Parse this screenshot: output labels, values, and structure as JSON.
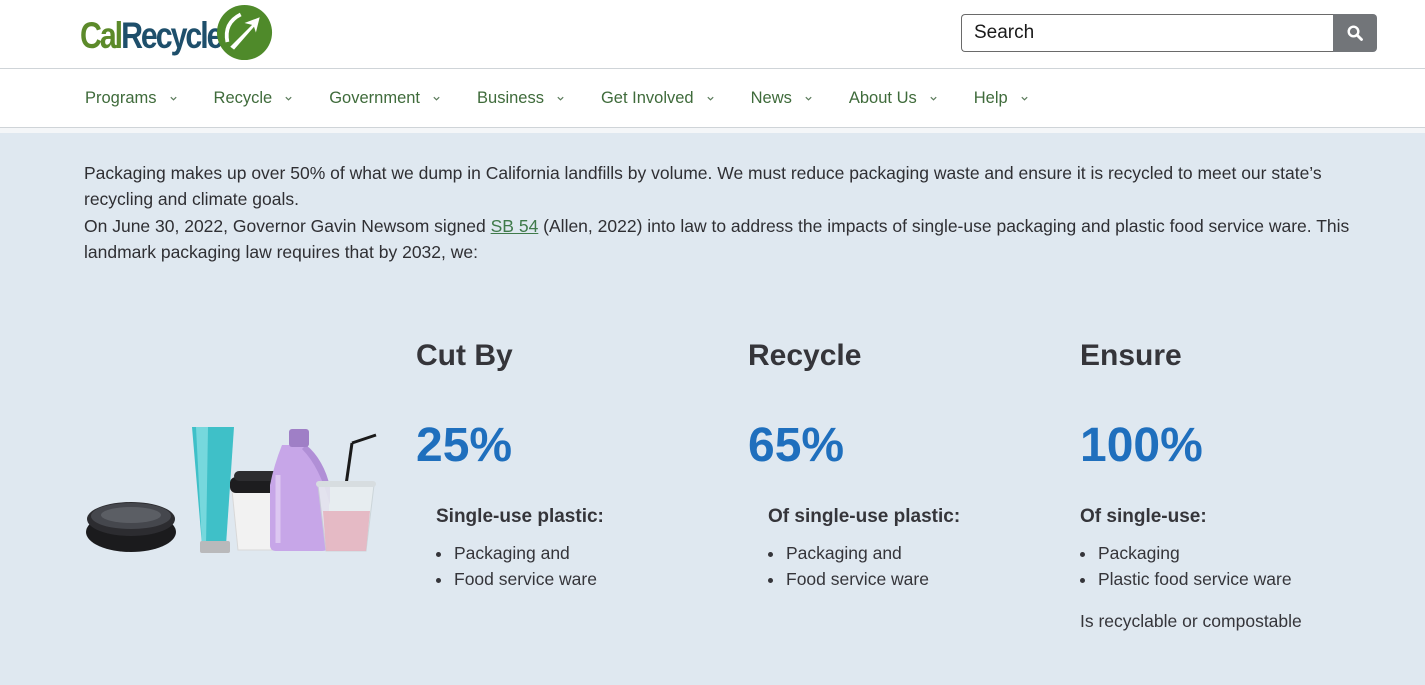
{
  "header": {
    "logo_part1": "Cal",
    "logo_part2": "Recycle",
    "search_placeholder": "Search"
  },
  "nav": {
    "items": [
      "Programs",
      "Recycle",
      "Government",
      "Business",
      "Get Involved",
      "News",
      "About Us",
      "Help"
    ]
  },
  "intro": {
    "para1": "Packaging makes up over 50% of what we dump in California landfills by volume. We must reduce packaging waste and ensure it is recycled to meet our state’s recycling and climate goals.",
    "para2_before": "On June 30, 2022, Governor Gavin Newsom signed ",
    "para2_link": "SB 54",
    "para2_after": " (Allen, 2022) into law to address the impacts of single-use packaging and plastic food service ware. This landmark packaging law requires that by 2032, we:"
  },
  "stats": [
    {
      "title": "Cut By",
      "pct": "25%",
      "sub": "Single-use plastic:",
      "items": [
        "Packaging and",
        "Food service ware"
      ],
      "note": ""
    },
    {
      "title": "Recycle",
      "pct": "65%",
      "sub": "Of single-use plastic:",
      "items": [
        "Packaging and",
        "Food service ware"
      ],
      "note": ""
    },
    {
      "title": "Ensure",
      "pct": "100%",
      "sub": "Of single-use:",
      "items": [
        "Packaging",
        "Plastic food service ware"
      ],
      "note": "Is recyclable or compostable"
    }
  ],
  "colors": {
    "accent_blue": "#1f6fbd",
    "nav_green": "#3f6b3b",
    "logo_green": "#5c8a2a",
    "logo_blue": "#1e4f6b",
    "band_background": "#dfe8f0"
  },
  "icons": {
    "search": "magnifier-icon",
    "chevron": "chevron-down-icon"
  }
}
